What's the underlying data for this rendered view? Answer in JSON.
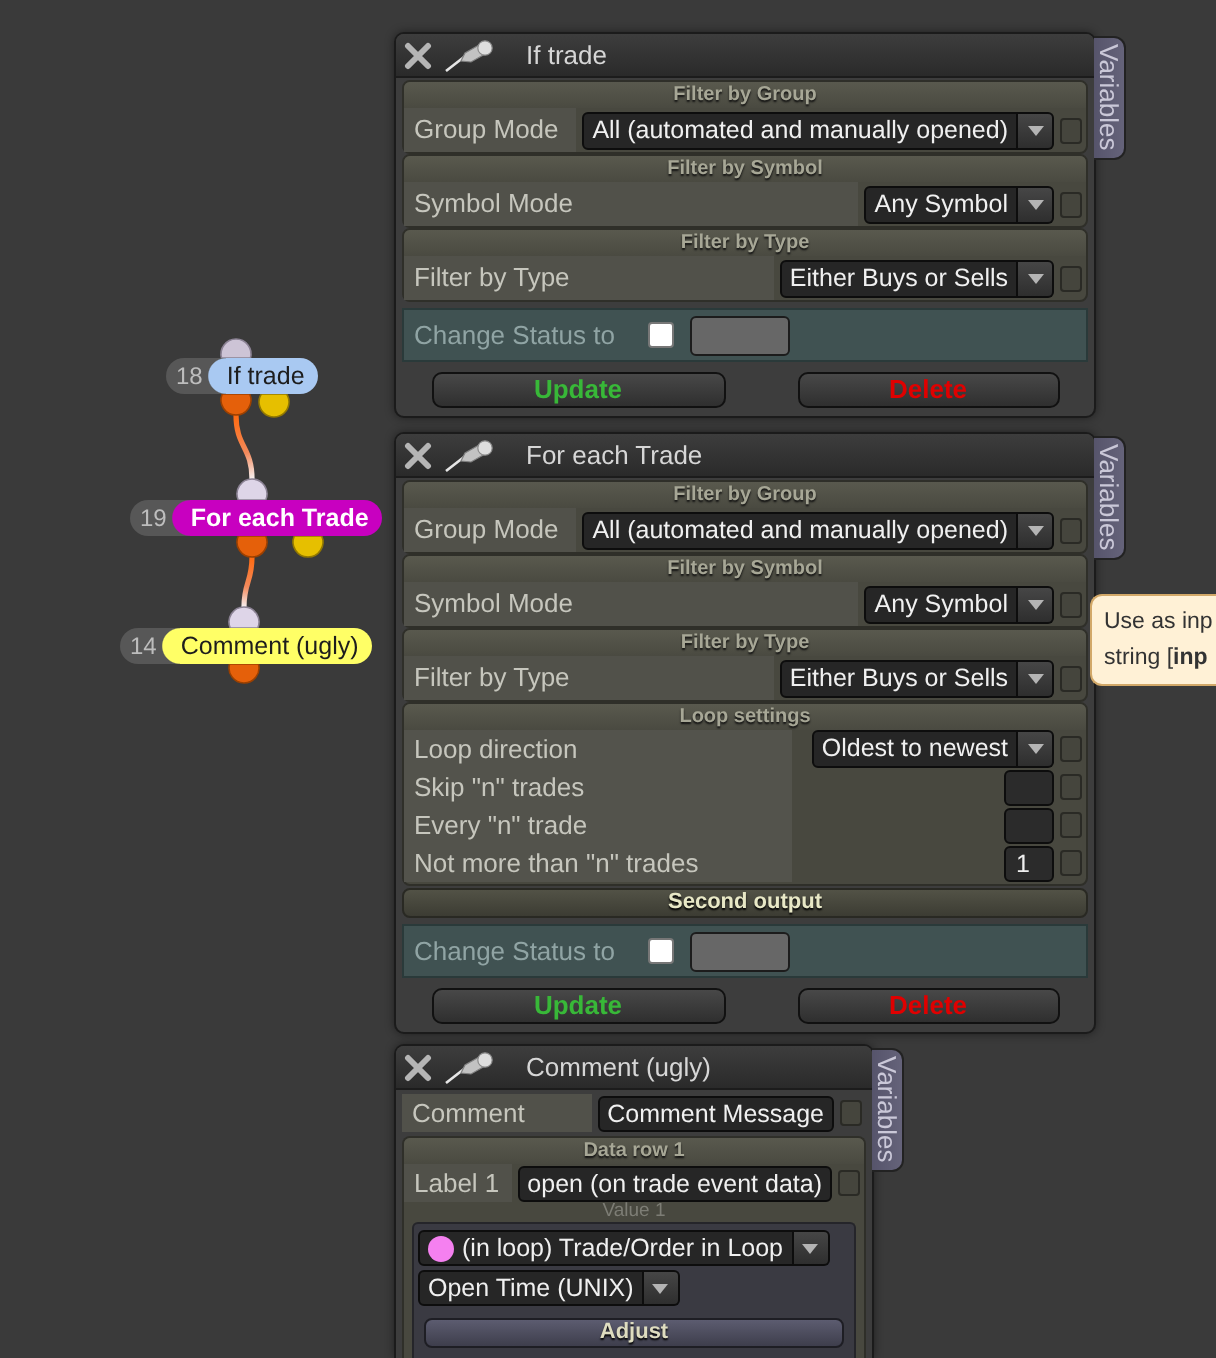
{
  "canvas_nodes": [
    {
      "number": "18",
      "label": "If trade",
      "color": "#a9c9f2",
      "input_connected": false,
      "second_output": true
    },
    {
      "number": "19",
      "label": "For each Trade",
      "color": "#c800c0",
      "input_connected": true,
      "second_output": true
    },
    {
      "number": "14",
      "label": "Comment (ugly)",
      "color": "#ffff66",
      "input_connected": true,
      "second_output": false
    }
  ],
  "panels": [
    {
      "title": "If trade",
      "side_tab": "Variables",
      "items": [
        {
          "kind": "filter_section",
          "header": "Filter by Group",
          "rows": [
            {
              "kind": "dropdown",
              "label": "Group Mode",
              "value": "All (automated and manually opened)",
              "checked": false
            }
          ]
        },
        {
          "kind": "filter_section",
          "header": "Filter by Symbol",
          "rows": [
            {
              "kind": "dropdown",
              "label": "Symbol Mode",
              "value": "Any Symbol",
              "checked": false
            }
          ]
        },
        {
          "kind": "filter_section",
          "header": "Filter by Type",
          "rows": [
            {
              "kind": "dropdown",
              "label": "Filter by Type",
              "value": "Either Buys or Sells",
              "checked": false
            }
          ]
        },
        {
          "kind": "status",
          "label": "Change Status to",
          "checked": false
        },
        {
          "kind": "buttons",
          "buttons": [
            {
              "kind": "update",
              "label": "Update"
            },
            {
              "kind": "delete",
              "label": "Delete"
            }
          ]
        }
      ]
    },
    {
      "title": "For each Trade",
      "side_tab": "Variables",
      "items": [
        {
          "kind": "filter_section",
          "header": "Filter by Group",
          "rows": [
            {
              "kind": "dropdown",
              "label": "Group Mode",
              "value": "All (automated and manually opened)",
              "checked": false
            }
          ]
        },
        {
          "kind": "filter_section",
          "header": "Filter by Symbol",
          "rows": [
            {
              "kind": "dropdown",
              "label": "Symbol Mode",
              "value": "Any Symbol",
              "checked": false
            }
          ]
        },
        {
          "kind": "filter_section",
          "header": "Filter by Type",
          "rows": [
            {
              "kind": "dropdown",
              "label": "Filter by Type",
              "value": "Either Buys or Sells",
              "checked": false
            }
          ]
        },
        {
          "kind": "settings_section",
          "header": "Loop settings",
          "rows": [
            {
              "kind": "dropdown",
              "label": "Loop direction",
              "value": "Oldest to newest",
              "checked": false
            },
            {
              "kind": "number",
              "label": "Skip \"n\" trades",
              "checked": false
            },
            {
              "kind": "number",
              "label": "Every \"n\" trade",
              "checked": false
            },
            {
              "kind": "number",
              "label": "Not more than \"n\" trades",
              "value": "1",
              "checked": false
            }
          ]
        },
        {
          "kind": "output_header",
          "header": "Second output"
        },
        {
          "kind": "status",
          "label": "Change Status to",
          "checked": false
        },
        {
          "kind": "buttons",
          "buttons": [
            {
              "kind": "update",
              "label": "Update"
            },
            {
              "kind": "delete",
              "label": "Delete"
            }
          ]
        }
      ]
    },
    {
      "title": "Comment (ugly)",
      "side_tab": "Variables",
      "items": [
        {
          "kind": "rows",
          "rows": [
            {
              "kind": "text",
              "label": "Comment",
              "value": "Comment Message",
              "checked": false
            }
          ]
        },
        {
          "kind": "data_section",
          "header": "Data row 1",
          "rows": [
            {
              "kind": "text",
              "label": "Label 1",
              "value": "open (on trade event data)",
              "checked": false
            }
          ],
          "value_header": "Value 1",
          "selects": [
            {
              "value": "(in loop) Trade/Order in Loop",
              "color": "#f580f0"
            },
            {
              "value": "Open Time (UNIX)"
            }
          ],
          "button": "Adjust"
        }
      ]
    }
  ],
  "tooltip": {
    "lines": [
      "Use as inp",
      "string [**inp**"
    ]
  }
}
